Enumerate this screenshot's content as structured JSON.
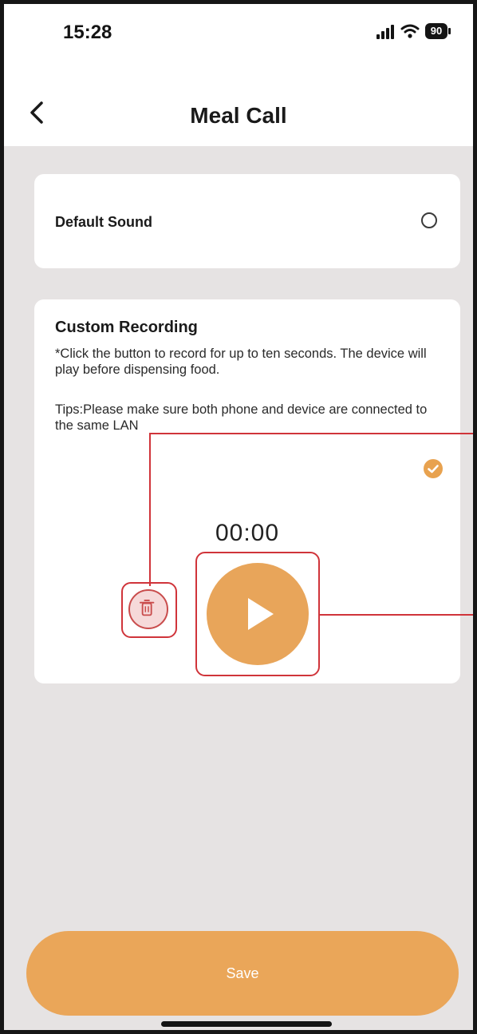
{
  "status_bar": {
    "time": "15:28",
    "battery": "90"
  },
  "header": {
    "title": "Meal Call",
    "back_icon": "chevron-left-icon"
  },
  "default_sound": {
    "label": "Default Sound",
    "selected": false
  },
  "custom_recording": {
    "title": "Custom Recording",
    "description": "*Click the button to record for up to ten seconds. The device will play before dispensing food.",
    "tips": "Tips:Please make sure both phone and device are connected to the same LAN",
    "selected": true,
    "timer": "00:00",
    "delete_icon": "trash-icon",
    "play_icon": "play-icon"
  },
  "footer": {
    "save_label": "Save"
  },
  "colors": {
    "accent": "#e8a55a",
    "background": "#e6e3e3",
    "card": "#ffffff",
    "highlight": "#d0343a",
    "delete": "#c94c4c"
  }
}
